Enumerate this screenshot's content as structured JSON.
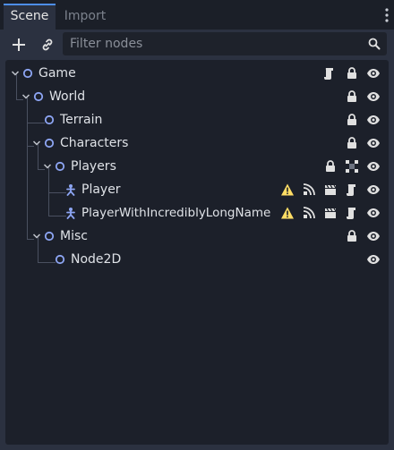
{
  "tabs": [
    {
      "label": "Scene",
      "active": true
    },
    {
      "label": "Import",
      "active": false
    }
  ],
  "toolbar": {
    "add_icon": "plus-icon",
    "link_icon": "link-icon"
  },
  "filter": {
    "placeholder": "Filter nodes",
    "value": ""
  },
  "tree": {
    "nodes": [
      {
        "name": "Game",
        "type": "node",
        "expanded": true,
        "icons": [
          "script-icon",
          "lock-icon",
          "eye-icon"
        ]
      },
      {
        "name": "World",
        "type": "node",
        "expanded": true,
        "icons": [
          "lock-icon",
          "eye-icon"
        ]
      },
      {
        "name": "Terrain",
        "type": "node",
        "icons": [
          "lock-icon",
          "eye-icon"
        ]
      },
      {
        "name": "Characters",
        "type": "node",
        "expanded": true,
        "icons": [
          "lock-icon",
          "eye-icon"
        ]
      },
      {
        "name": "Players",
        "type": "node",
        "expanded": true,
        "icons": [
          "lock-icon",
          "group-icon",
          "eye-icon"
        ]
      },
      {
        "name": "Player",
        "type": "instanced-scene",
        "icons": [
          "warning-icon",
          "signal-icon",
          "clapperboard-icon",
          "script-icon",
          "eye-icon"
        ]
      },
      {
        "name": "PlayerWithIncrediblyLongName",
        "type": "instanced-scene",
        "icons": [
          "warning-icon",
          "signal-icon",
          "clapperboard-icon",
          "script-icon",
          "eye-icon"
        ]
      },
      {
        "name": "Misc",
        "type": "node",
        "expanded": true,
        "icons": [
          "lock-icon",
          "eye-icon"
        ]
      },
      {
        "name": "Node2D",
        "type": "node2d",
        "icons": [
          "eye-icon"
        ]
      }
    ]
  },
  "colors": {
    "background": "#202531",
    "panel": "#2b3140",
    "tree_bg": "#1c202a",
    "accent": "#4d8ee8",
    "node_icon": "#8da5f3",
    "warning": "#ffdd65"
  }
}
